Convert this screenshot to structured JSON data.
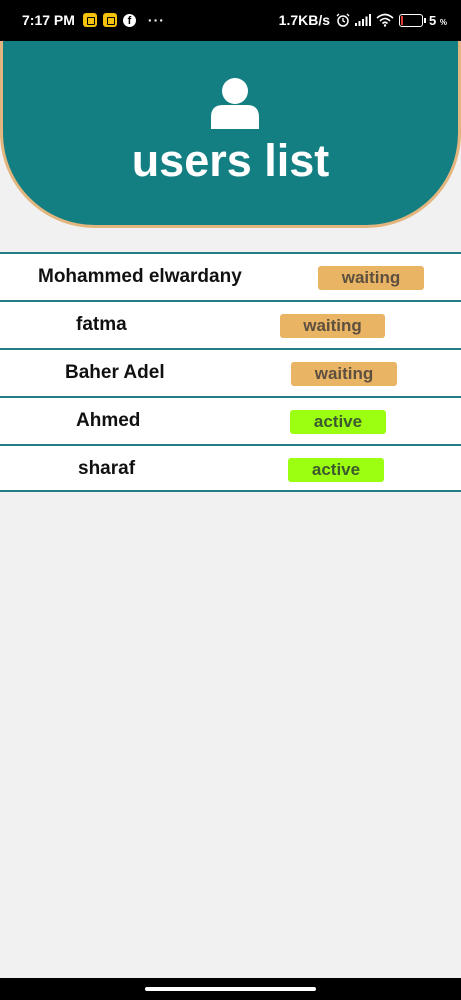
{
  "status_bar": {
    "time": "7:17 PM",
    "more": "···",
    "network_speed": "1.7KB/s",
    "battery_percent": "5",
    "battery_unit": "%",
    "icons": [
      "notification-icon",
      "notification-icon",
      "facebook-icon",
      "alarm-icon",
      "signal-icon",
      "wifi-icon",
      "battery-icon"
    ]
  },
  "header": {
    "title": "users list",
    "icon": "user-icon",
    "background_color": "#147f82",
    "border_color": "#e2b67e"
  },
  "users": [
    {
      "name": "Mohammed elwardany",
      "status": "waiting"
    },
    {
      "name": "fatma",
      "status": "waiting"
    },
    {
      "name": "Baher Adel",
      "status": "waiting"
    },
    {
      "name": "Ahmed",
      "status": "active"
    },
    {
      "name": "sharaf",
      "status": "active"
    }
  ],
  "status_colors": {
    "waiting": "#e9b463",
    "active": "#9cfe10"
  }
}
